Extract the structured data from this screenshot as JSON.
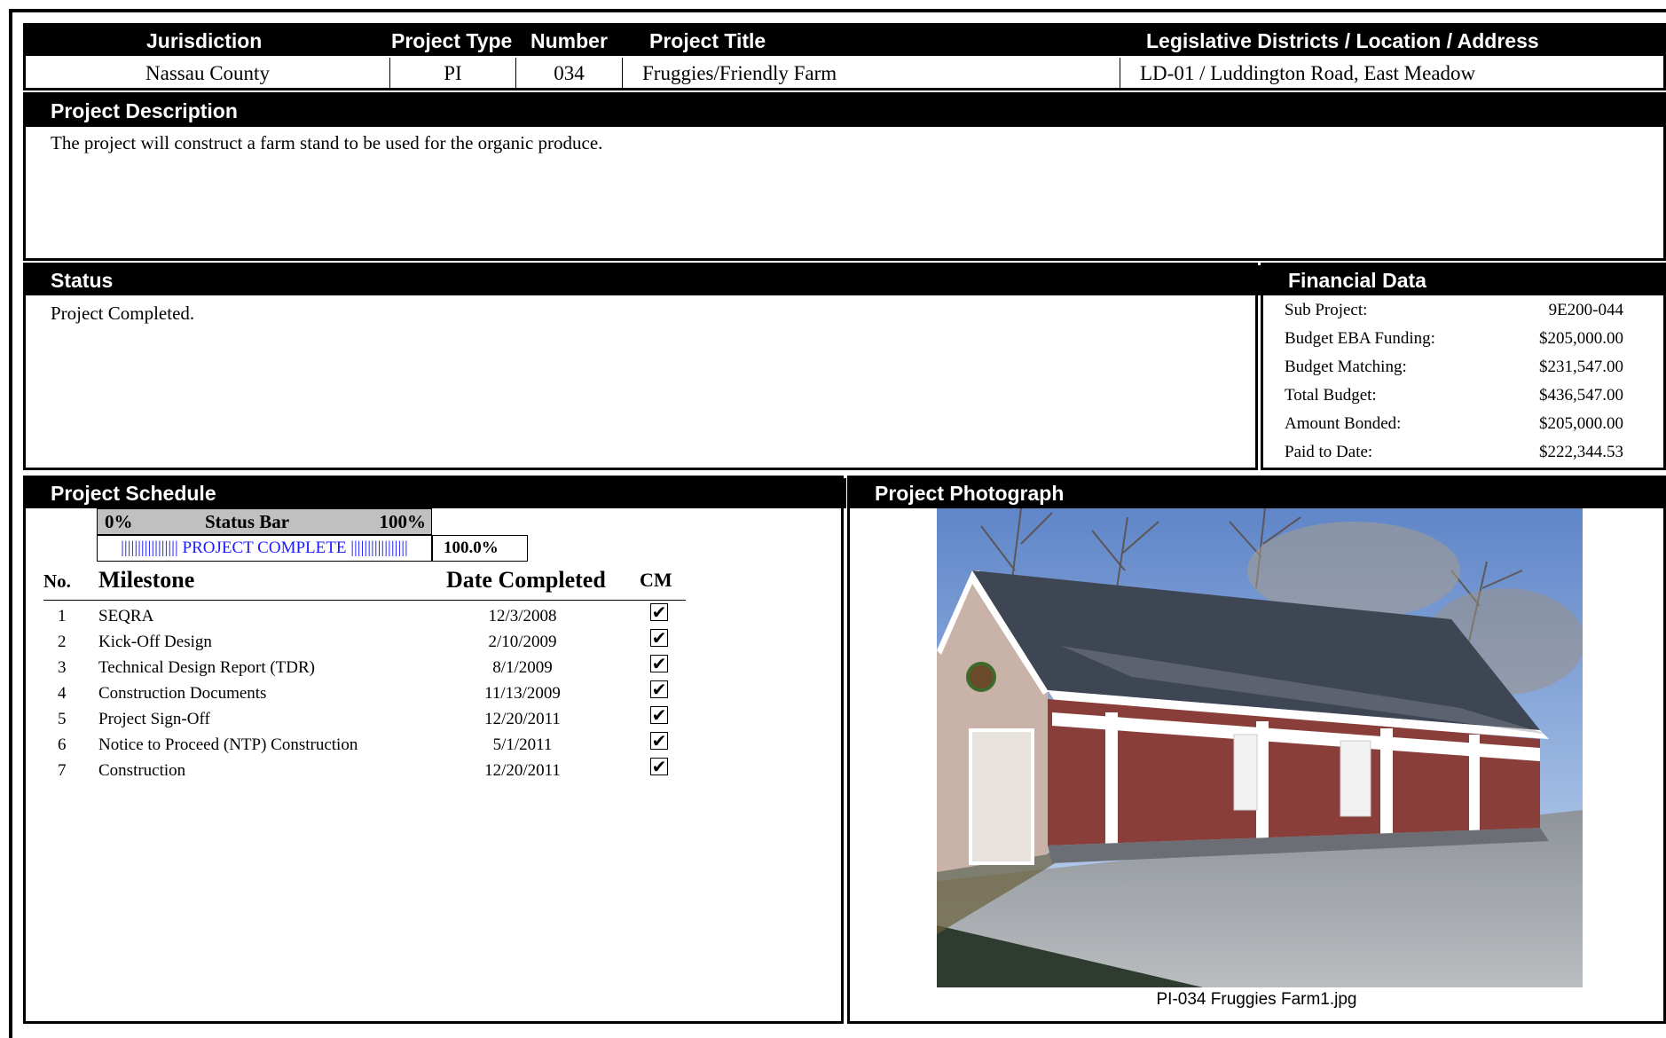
{
  "header": {
    "columns": [
      "Jurisdiction",
      "Project Type",
      "Number",
      "Project Title",
      "Legislative Districts / Location / Address"
    ],
    "jurisdiction": "Nassau County",
    "project_type": "PI",
    "number": "034",
    "project_title": "Fruggies/Friendly Farm",
    "location": "LD-01 / Luddington Road, East Meadow"
  },
  "description": {
    "title": "Project Description",
    "text": "The project will construct a farm stand to be used for the organic produce."
  },
  "status": {
    "title": "Status",
    "text": "Project Completed."
  },
  "financial": {
    "title": "Financial Data",
    "rows": [
      {
        "label": "Sub Project:",
        "value": "9E200-044"
      },
      {
        "label": "Budget EBA Funding:",
        "value": "$205,000.00"
      },
      {
        "label": "Budget Matching:",
        "value": "$231,547.00"
      },
      {
        "label": "Total Budget:",
        "value": "$436,547.00"
      },
      {
        "label": "Amount Bonded:",
        "value": "$205,000.00"
      },
      {
        "label": "Paid to Date:",
        "value": "$222,344.53"
      }
    ]
  },
  "schedule": {
    "title": "Project Schedule",
    "status_bar": {
      "left_label": "0%",
      "center_label": "Status Bar",
      "right_label": "100%",
      "bar_text": "||||||||||||||||| PROJECT COMPLETE |||||||||||||||||",
      "percent_text": "100.0%",
      "progress": 1.0,
      "color": "#1a1aff"
    },
    "columns": {
      "no": "No.",
      "milestone": "Milestone",
      "date": "Date Completed",
      "cm": "CM"
    },
    "milestones": [
      {
        "no": "1",
        "name": "SEQRA",
        "date": "12/3/2008",
        "cm": true
      },
      {
        "no": "2",
        "name": "Kick-Off Design",
        "date": "2/10/2009",
        "cm": true
      },
      {
        "no": "3",
        "name": "Technical Design Report (TDR)",
        "date": "8/1/2009",
        "cm": true
      },
      {
        "no": "4",
        "name": "Construction Documents",
        "date": "11/13/2009",
        "cm": true
      },
      {
        "no": "5",
        "name": "Project Sign-Off",
        "date": "12/20/2011",
        "cm": true
      },
      {
        "no": "6",
        "name": "Notice to Proceed (NTP) Construction",
        "date": "5/1/2011",
        "cm": true
      },
      {
        "no": "7",
        "name": "Construction",
        "date": "12/20/2011",
        "cm": true
      }
    ]
  },
  "photo": {
    "title": "Project Photograph",
    "caption": "PI-034 Fruggies Farm1.jpg"
  }
}
